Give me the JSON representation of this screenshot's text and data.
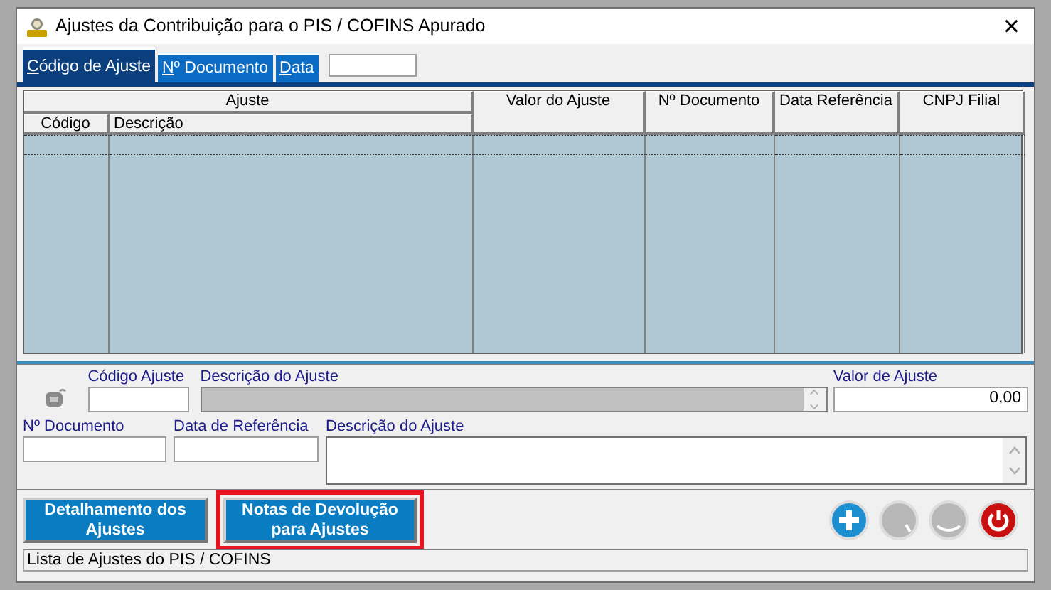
{
  "window": {
    "title": "Ajustes da Contribuição para o PIS / COFINS Apurado",
    "close": "×"
  },
  "search_tabs": [
    {
      "label": "Código de Ajuste",
      "selected": true
    },
    {
      "label": "Nº Documento",
      "selected": false
    },
    {
      "label": "Data",
      "selected": false
    }
  ],
  "table": {
    "group_header": "Ajuste",
    "columns": [
      "Código",
      "Descrição",
      "Valor do Ajuste",
      "Nº Documento",
      "Data Referência",
      "CNPJ Filial"
    ]
  },
  "form": {
    "row_1": [
      {
        "label": "Código Ajuste",
        "kind": "input",
        "disabled": false
      },
      {
        "label": "Descrição do Ajuste",
        "kind": "memo",
        "disabled": true
      },
      {
        "label": "Valor de Ajuste",
        "kind": "number",
        "value": "0,00",
        "disabled": false
      }
    ],
    "row_2": [
      {
        "label": "Nº Documento",
        "kind": "input",
        "disabled": false
      },
      {
        "label": "Data de Referência",
        "kind": "input",
        "disabled": false
      },
      {
        "label": "Descrição do Ajuste",
        "kind": "memo",
        "disabled": false
      }
    ]
  },
  "buttons": [
    {
      "label": "Detalhamento dos Ajustes",
      "highlighted": false
    },
    {
      "label": "Notas de Devolução para Ajustes",
      "highlighted": true
    }
  ],
  "actions": [
    {
      "kind": "add",
      "disabled": false
    },
    {
      "kind": "edit",
      "disabled": true
    },
    {
      "kind": "delete",
      "disabled": true
    },
    {
      "kind": "exit",
      "disabled": false
    }
  ],
  "status_bar": "Lista de Ajustes do PIS / COFINS"
}
